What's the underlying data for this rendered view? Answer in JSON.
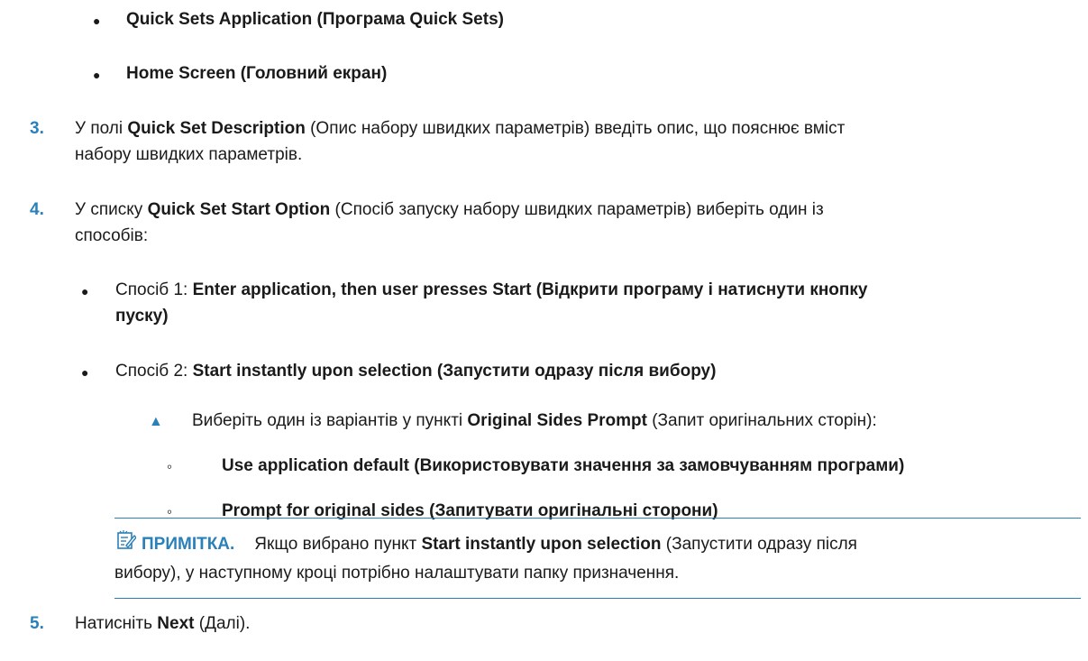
{
  "top_bullets": [
    "Quick Sets Application (Програма Quick Sets)",
    "Home Screen (Головний екран)"
  ],
  "step3": {
    "num": "3.",
    "pre": "У полі ",
    "bold": "Quick Set Description",
    "line1_rest": " (Опис набору швидких параметрів) введіть опис, що пояснює вміст",
    "line2": "набору швидких параметрів."
  },
  "step4": {
    "num": "4.",
    "pre": "У списку ",
    "bold": "Quick Set Start Option",
    "line1_rest": " (Спосіб запуску набору швидких параметрів) виберіть один із",
    "line2": "способів:"
  },
  "options": [
    {
      "prefix": "Спосіб 1: ",
      "bold_line1": "Enter application, then user presses Start (Відкрити програму і натиснути кнопку",
      "bold_line2": "пуску)"
    },
    {
      "prefix": "Спосіб 2: ",
      "bold_line1": "Start instantly upon selection (Запустити одразу після вибору)"
    }
  ],
  "sub": {
    "pre": "Виберіть один із варіантів у пункті ",
    "bold": "Original Sides Prompt",
    "post": " (Запит оригінальних сторін):",
    "items": [
      "Use application default (Використовувати значення за замовчуванням програми)",
      "Prompt for original sides (Запитувати оригінальні сторони)"
    ]
  },
  "note": {
    "label": "ПРИМІТКА.",
    "pre": "Якщо вибрано пункт ",
    "bold": "Start instantly upon selection",
    "line1_rest": " (Запустити одразу після",
    "line2": "вибору), у наступному кроці потрібно налаштувати папку призначення."
  },
  "step5": {
    "num": "5.",
    "pre": "Натисніть ",
    "bold": "Next",
    "post": " (Далі)."
  },
  "colors": {
    "accent": "#2a80b9",
    "text": "#1a1a1a"
  },
  "icons": {
    "note": "note-pencil-icon"
  }
}
